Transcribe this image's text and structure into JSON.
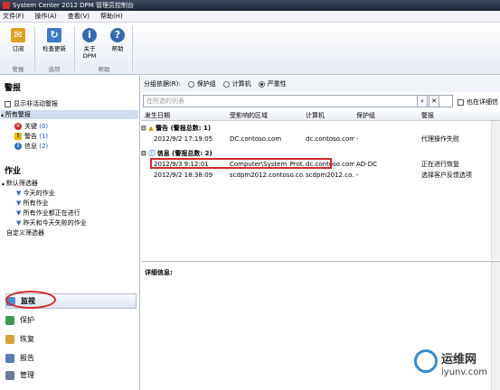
{
  "window": {
    "title": "System Center 2012 DPM 管理员控制台"
  },
  "menu": [
    "文件(F)",
    "操作(A)",
    "查看(V)",
    "帮助(H)"
  ],
  "ribbon": {
    "buttons": [
      "订阅",
      "检查更新",
      "关于\nDPM",
      "帮助"
    ],
    "groups": [
      "警报",
      "选项",
      "帮助"
    ]
  },
  "left": {
    "alerts_heading": "警报",
    "show_inactive": "显示非活动警报",
    "all_alerts": "所有警报",
    "critical": {
      "label": "关键",
      "count": "(0)"
    },
    "warning": {
      "label": "警告",
      "count": "(1)"
    },
    "info": {
      "label": "信息",
      "count": "(2)"
    },
    "jobs_heading": "作业",
    "default_filters": "默认筛选器",
    "filters": [
      "今天的作业",
      "所有作业",
      "所有作业都正在进行",
      "昨天和今天失败的作业"
    ],
    "custom_filters": "自定义筛选器",
    "nav": [
      "监视",
      "保护",
      "恢复",
      "报告",
      "管理"
    ]
  },
  "main": {
    "group_by_label": "分组依据(R):",
    "group_options": [
      "保护组",
      "计算机",
      "严重性"
    ],
    "search_placeholder": "在所选的列表",
    "also_details": "也在详细信",
    "columns": [
      "发生日期",
      "受影响的区域",
      "计算机",
      "保护组",
      "警报"
    ],
    "warning_group": "警告 (警报总数: 1)",
    "info_group": "信息 (警报总数: 2)",
    "rows": [
      [
        "2012/9/2 17:19:05",
        "DC.contoso.com",
        "dc.contoso.com",
        "-",
        "代理操作失败"
      ],
      [
        "2012/9/3 9:12:01",
        "Computer\\System_Prot...",
        "dc.contoso.com",
        "AD-DC",
        "正在进行恢复"
      ],
      [
        "2012/9/2 18:38:09",
        "scdpm2012.contoso.co...",
        "scdpm2012.co...",
        "-",
        "选择客户反馈选项"
      ]
    ],
    "details_label": "详细信息:"
  },
  "watermark": {
    "cn": "运维网",
    "url": "iyunv.com"
  }
}
